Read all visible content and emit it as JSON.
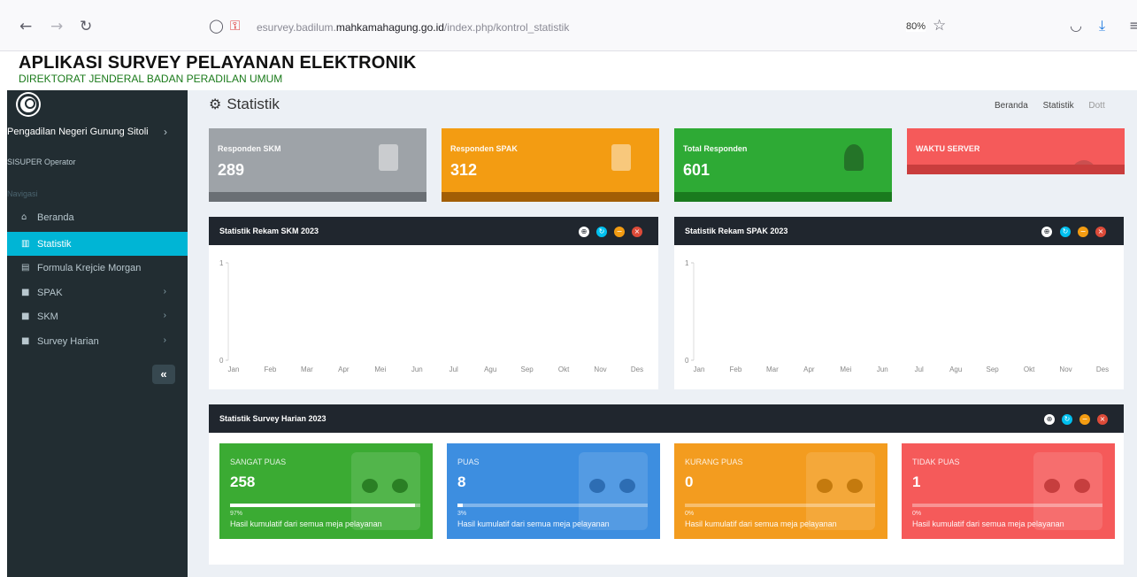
{
  "browser": {
    "url_prefix": "esurvey.badilum.",
    "url_domain": "mahkamahagung.go.id",
    "url_path": "/index.php/kontrol_statistik",
    "zoom": "80%"
  },
  "app": {
    "title": "APLIKASI SURVEY PELAYANAN ELEKTRONIK",
    "subtitle": "DIREKTORAT JENDERAL BADAN PERADILAN UMUM"
  },
  "sidebar": {
    "user_name": "Pengadilan Negeri Gunung Sitoli",
    "user_role": "SISUPER Operator",
    "nav_header": "Navigasi",
    "items": [
      {
        "label": "Beranda",
        "icon": "home-icon",
        "glyph": "⌂",
        "chevron": ""
      },
      {
        "label": "Statistik",
        "icon": "chart-icon",
        "glyph": "▥",
        "chevron": ""
      },
      {
        "label": "Formula Krejcie Morgan",
        "icon": "calculator-icon",
        "glyph": "▤",
        "chevron": ""
      },
      {
        "label": "SPAK",
        "icon": "file-icon",
        "glyph": "■",
        "chevron": "›"
      },
      {
        "label": "SKM",
        "icon": "file-icon",
        "glyph": "■",
        "chevron": "›"
      },
      {
        "label": "Survey Harian",
        "icon": "file-icon",
        "glyph": "■",
        "chevron": "›"
      }
    ],
    "collapse_glyph": "«"
  },
  "page": {
    "title": "Statistik",
    "breadcrumb": [
      "Beranda",
      "Statistik",
      "Dott"
    ]
  },
  "stat_boxes": [
    {
      "title": "Responden SKM",
      "value": "289",
      "color": "#9ea3a8",
      "footer": "#6a6f74"
    },
    {
      "title": "Responden SPAK",
      "value": "312",
      "color": "#f39c12",
      "footer": "#a25e05"
    },
    {
      "title": "Total Responden",
      "value": "601",
      "color": "#2eaa35",
      "footer": "#1a7a1e"
    },
    {
      "title": "WAKTU SERVER",
      "value": "",
      "color": "#f55a5a",
      "footer": "#c93d3d"
    }
  ],
  "panels": {
    "skm_title": "Statistik Rekam SKM 2023",
    "spak_title": "Statistik Rekam SPAK 2023",
    "harian_title": "Statistik Survey Harian 2023"
  },
  "chart_data": [
    {
      "type": "line",
      "title": "Statistik Rekam SKM 2023",
      "categories": [
        "Jan",
        "Feb",
        "Mar",
        "Apr",
        "Mei",
        "Jun",
        "Jul",
        "Agu",
        "Sep",
        "Okt",
        "Nov",
        "Des"
      ],
      "ylim": [
        0,
        1
      ],
      "y_ticks": [
        "0",
        "1"
      ],
      "series": []
    },
    {
      "type": "line",
      "title": "Statistik Rekam SPAK 2023",
      "categories": [
        "Jan",
        "Feb",
        "Mar",
        "Apr",
        "Mei",
        "Jun",
        "Jul",
        "Agu",
        "Sep",
        "Okt",
        "Nov",
        "Des"
      ],
      "ylim": [
        0,
        1
      ],
      "y_ticks": [
        "0",
        "1"
      ],
      "series": []
    }
  ],
  "mood_boxes": [
    {
      "label": "SANGAT PUAS",
      "value": "258",
      "pct_text": "97%",
      "progress": 0.97,
      "desc": "Hasil kumulatif dari semua meja pelayanan",
      "color": "#3bab33",
      "icon": "happy-face-icon"
    },
    {
      "label": "PUAS",
      "value": "8",
      "pct_text": "3%",
      "progress": 0.03,
      "desc": "Hasil kumulatif dari semua meja pelayanan",
      "color": "#3d8ee0",
      "icon": "neutral-face-icon"
    },
    {
      "label": "KURANG PUAS",
      "value": "0",
      "pct_text": "0%",
      "progress": 0.0,
      "desc": "Hasil kumulatif dari semua meja pelayanan",
      "color": "#f39c1f",
      "icon": "meh-face-icon"
    },
    {
      "label": "TIDAK PUAS",
      "value": "1",
      "pct_text": "0%",
      "progress": 0.0,
      "desc": "Hasil kumulatif dari semua meja pelayanan",
      "color": "#f55a5a",
      "icon": "sad-face-icon"
    }
  ]
}
